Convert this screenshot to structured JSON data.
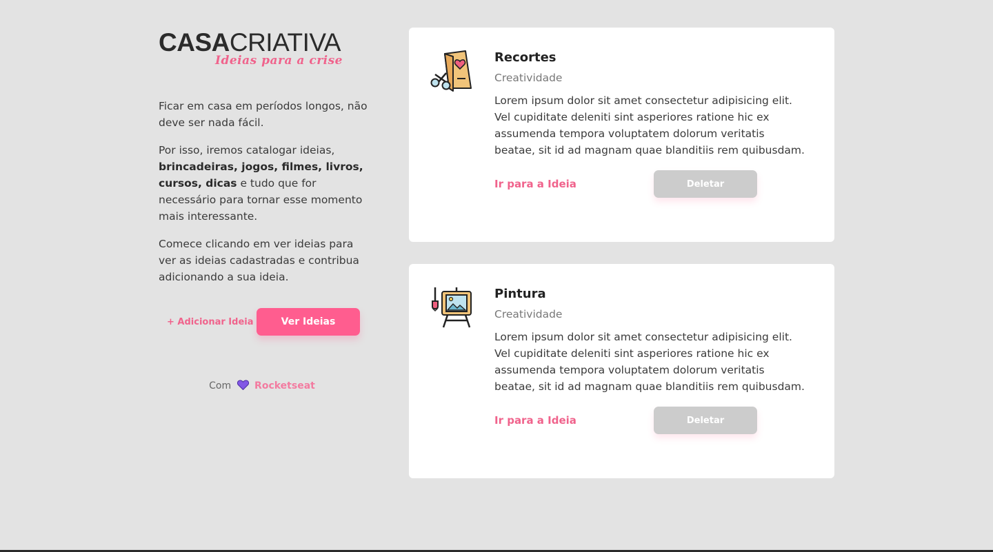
{
  "logo": {
    "bold_part": "CASA",
    "light_part": "CRIATIVA",
    "tagline": "Ideias para a crise"
  },
  "intro": {
    "p1": "Ficar em casa em períodos longos, não deve ser nada fácil.",
    "p2_before": "Por isso, iremos catalogar ideias, ",
    "p2_bold": "brincadeiras, jogos, filmes, livros, cursos, dicas",
    "p2_after": " e tudo que for necessário para tornar esse momento mais interessante.",
    "p3": "Comece clicando em ver ideias para ver as ideias cadastradas e contribua adicionando a sua ideia."
  },
  "actions": {
    "add_label": "+ Adicionar Ideia",
    "view_label": "Ver Ideias"
  },
  "credits": {
    "prefix": "Com",
    "brand": "Rocketseat",
    "heart_color": "#8257e5"
  },
  "colors": {
    "accent": "#ff5d8f",
    "background": "#e3e3e3"
  },
  "ideas": [
    {
      "title": "Recortes",
      "category": "Creatividade",
      "description": "Lorem ipsum dolor sit amet consectetur adipisicing elit. Vel cupiditate deleniti sint asperiores ratione hic ex assumenda tempora voluptatem dolorum veritatis beatae, sit id ad magnam quae blanditiis rem quibusdam.",
      "link_label": "Ir para a Ideia",
      "delete_label": "Deletar",
      "icon": "scissors-card-icon"
    },
    {
      "title": "Pintura",
      "category": "Creatividade",
      "description": "Lorem ipsum dolor sit amet consectetur adipisicing elit. Vel cupiditate deleniti sint asperiores ratione hic ex assumenda tempora voluptatem dolorum veritatis beatae, sit id ad magnam quae blanditiis rem quibusdam.",
      "link_label": "Ir para a Ideia",
      "delete_label": "Deletar",
      "icon": "easel-painting-icon"
    }
  ]
}
